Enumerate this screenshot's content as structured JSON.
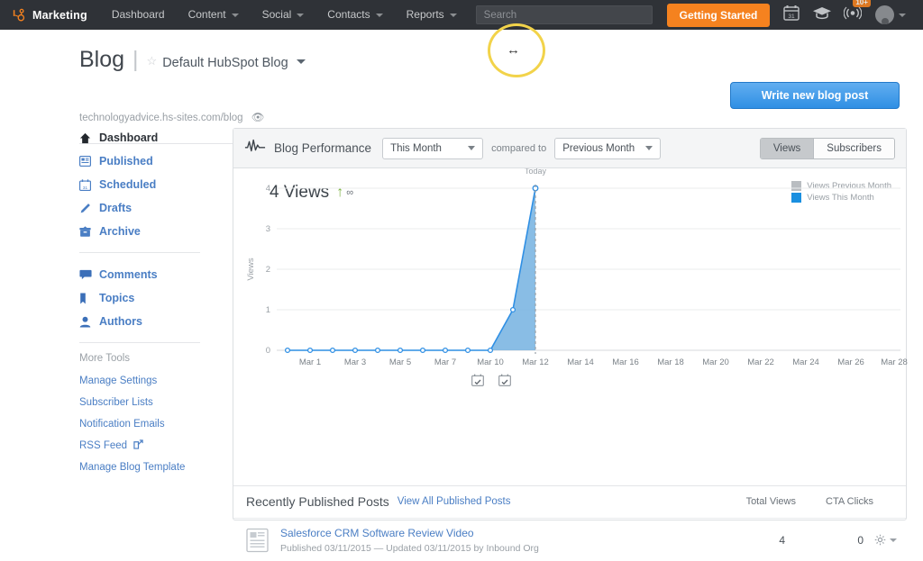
{
  "topnav": {
    "brand": "Marketing",
    "brand_logo_icon": "hubspot-sprocket-icon",
    "items": [
      {
        "label": "Dashboard",
        "caret": false
      },
      {
        "label": "Content",
        "caret": true
      },
      {
        "label": "Social",
        "caret": true
      },
      {
        "label": "Contacts",
        "caret": true
      },
      {
        "label": "Reports",
        "caret": true
      }
    ],
    "search_placeholder": "Search",
    "search_value": "",
    "getting_started": "Getting Started",
    "calendar_icon": "calendar-31-icon",
    "calendar_day": "31",
    "academy_icon": "graduation-cap-icon",
    "notifications_icon": "broadcast-icon",
    "notifications_badge": "10+",
    "avatar_icon": "user-avatar-icon",
    "accent_orange": "#f5821f",
    "bar_background": "#2f3237"
  },
  "pageheader": {
    "blog_word": "Blog",
    "separator": "|",
    "star_icon": "star-outline-icon",
    "blog_name": "Default HubSpot Blog",
    "url": "technologyadvice.hs-sites.com/blog",
    "eye_icon": "eye-icon",
    "write_button": "Write new blog post",
    "write_button_color": "#2f8fe4"
  },
  "annotation": {
    "highlight_icon": "yellow-circle-highlight",
    "highlight_color": "#f2d34a",
    "cursor_icon": "horizontal-resize-cursor",
    "cursor_glyph": "↔"
  },
  "sidebar": {
    "items": [
      {
        "label": "Dashboard",
        "icon": "home-icon",
        "active": true
      },
      {
        "label": "Published",
        "icon": "published-article-icon",
        "active": false
      },
      {
        "label": "Scheduled",
        "icon": "calendar-icon",
        "active": false
      },
      {
        "label": "Drafts",
        "icon": "pencil-icon",
        "active": false
      },
      {
        "label": "Archive",
        "icon": "archive-box-icon",
        "active": false
      }
    ],
    "items2": [
      {
        "label": "Comments",
        "icon": "speech-bubble-icon"
      },
      {
        "label": "Topics",
        "icon": "bookmark-icon"
      },
      {
        "label": "Authors",
        "icon": "person-icon"
      }
    ],
    "more_tools_label": "More Tools",
    "links": [
      {
        "label": "Manage Settings",
        "external": false
      },
      {
        "label": "Subscriber Lists",
        "external": false
      },
      {
        "label": "Notification Emails",
        "external": false
      },
      {
        "label": "RSS Feed",
        "external": true
      },
      {
        "label": "Manage Blog Template",
        "external": false
      }
    ],
    "link_color": "#4a7ec4"
  },
  "panel": {
    "pulse_icon": "pulse-waveform-icon",
    "title": "Blog Performance",
    "range_select": "This Month",
    "compared_to_label": "compared to",
    "compare_select": "Previous Month",
    "toggle": [
      {
        "label": "Views",
        "selected": true
      },
      {
        "label": "Subscribers",
        "selected": false
      }
    ],
    "big_stat": "4 Views",
    "trend_arrow": "↑",
    "trend_value": "∞",
    "trend_color": "#7cb342",
    "calendar_marker_icon": "calendar-check-icon",
    "calendar_markers": 2
  },
  "chart_data": {
    "type": "area",
    "title": "Blog Performance",
    "xlabel": "",
    "ylabel": "Views",
    "ylim": [
      0,
      4
    ],
    "yticks": [
      0,
      1,
      2,
      3,
      4
    ],
    "grid": true,
    "legend_position": "top-right",
    "x_tick_labels": [
      "Mar 1",
      "Mar 3",
      "Mar 5",
      "Mar 7",
      "Mar 10",
      "Mar 12",
      "Mar 14",
      "Mar 16",
      "Mar 18",
      "Mar 20",
      "Mar 22",
      "Mar 24",
      "Mar 26",
      "Mar 28"
    ],
    "annotations": [
      {
        "text": "Today",
        "x": "Mar 12",
        "style": "dashed-vertical-line"
      }
    ],
    "series": [
      {
        "name": "Views This Month",
        "color": "#2f8fe4",
        "fill": "#74b2e0",
        "x": [
          "Feb 28",
          "Mar 1",
          "Mar 2",
          "Mar 3",
          "Mar 4",
          "Mar 5",
          "Mar 6",
          "Mar 7",
          "Mar 8",
          "Mar 9",
          "Mar 10",
          "Mar 11",
          "Mar 12"
        ],
        "values": [
          0,
          0,
          0,
          0,
          0,
          0,
          0,
          0,
          0,
          0,
          0,
          1,
          4
        ]
      },
      {
        "name": "Views Previous Month",
        "color": "#b9bdc1",
        "fill": "#b9bdc1",
        "x": [],
        "values": []
      }
    ],
    "legend": [
      {
        "label": "Views Previous Month",
        "color": "#b9bdc1"
      },
      {
        "label": "Views This Month",
        "color": "#1a8fe0"
      }
    ]
  },
  "recent_posts": {
    "section_title": "Recently Published Posts",
    "view_all_link": "View All Published Posts",
    "columns": [
      "Total Views",
      "CTA Clicks"
    ],
    "rows": [
      {
        "doc_icon": "document-icon",
        "title": "Salesforce CRM Software Review Video",
        "meta": "Published 03/11/2015 — Updated 03/11/2015 by Inbound Org",
        "total_views": "4",
        "cta_clicks": "0",
        "gear_icon": "gear-icon"
      }
    ]
  }
}
